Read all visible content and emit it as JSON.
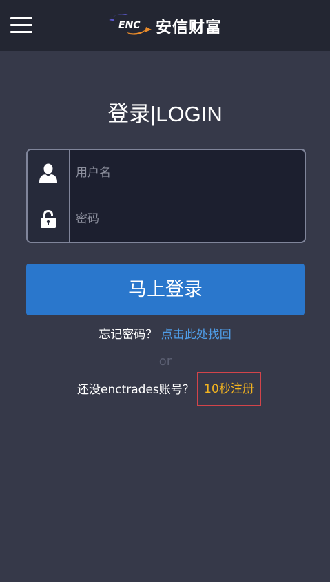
{
  "header": {
    "menu_icon": "hamburger-menu-icon",
    "logo_mark": "ENC",
    "logo_text": "安信财富"
  },
  "login": {
    "title": "登录|LOGIN",
    "username_placeholder": "用户名",
    "username_icon": "user-icon",
    "password_placeholder": "密码",
    "password_icon": "lock-icon",
    "submit_label": "马上登录"
  },
  "forgot": {
    "prompt": "忘记密码？",
    "link": "点击此处找回"
  },
  "divider": {
    "text": "or"
  },
  "signup": {
    "prompt": "还没enctrades账号？",
    "link": "10秒注册"
  },
  "colors": {
    "background": "#363949",
    "header": "#232632",
    "button": "#2a77cc",
    "link_blue": "#4f9de8",
    "link_gold": "#f2b320",
    "highlight_border": "#d2444a"
  }
}
